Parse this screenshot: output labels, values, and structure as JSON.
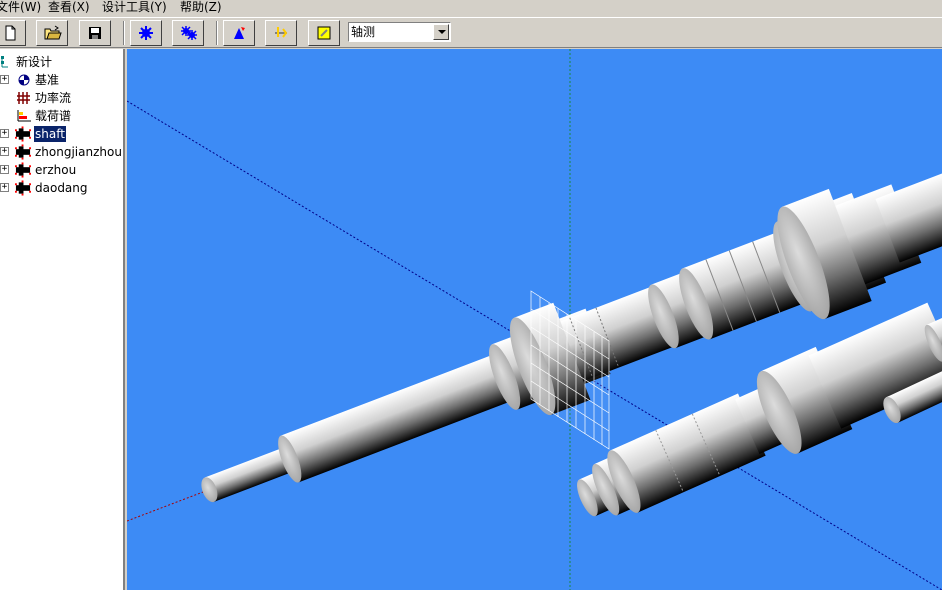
{
  "menu": {
    "file": "文件(W)",
    "view": "查看(X)",
    "design_tools": "设计工具(Y)",
    "help": "帮助(Z)"
  },
  "toolbar": {
    "view_mode": "轴测",
    "icons": [
      "new-file-icon",
      "open-folder-icon",
      "save-icon",
      "gear-icon",
      "gear-alt-icon",
      "cone-icon",
      "load-icon",
      "note-icon"
    ]
  },
  "tree": {
    "root": "新设计",
    "items": [
      {
        "label": "基准"
      },
      {
        "label": "功率流"
      },
      {
        "label": "载荷谱"
      },
      {
        "label": "shaft"
      },
      {
        "label": "zhongjianzhou"
      },
      {
        "label": "erzhou"
      },
      {
        "label": "daodang"
      }
    ]
  },
  "colors": {
    "viewport_bg": "#3d8bf5",
    "selection": "#0a246a",
    "shaft_light": "#ffffff",
    "shaft_dark": "#000000"
  }
}
